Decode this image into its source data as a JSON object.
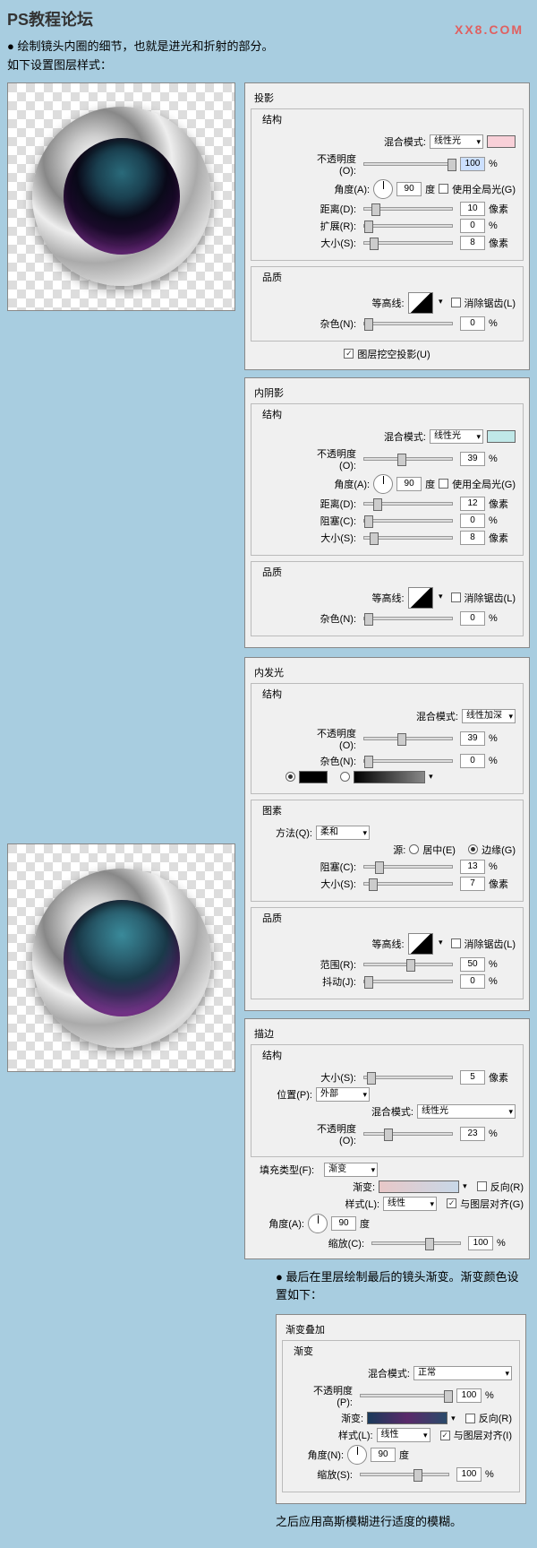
{
  "header": "PS教程论坛",
  "watermark": "XX8.COM",
  "intro1": "● 绘制镜头内圈的细节，也就是进光和折射的部分。",
  "intro2": "如下设置图层样式：",
  "p1": {
    "title": "投影",
    "group": "结构",
    "blend_lbl": "混合模式:",
    "blend": "线性光",
    "opac_lbl": "不透明度(O):",
    "opac": "100",
    "pct": "%",
    "angle_lbl": "角度(A):",
    "angle": "90",
    "deg": "度",
    "global_lbl": "使用全局光(G)",
    "dist_lbl": "距离(D):",
    "dist": "10",
    "px": "像素",
    "spread_lbl": "扩展(R):",
    "spread": "0",
    "size_lbl": "大小(S):",
    "size": "8",
    "quality": "品质",
    "contour_lbl": "等高线:",
    "aa_lbl": "消除锯齿(L)",
    "noise_lbl": "杂色(N):",
    "noise": "0",
    "knockout": "图层挖空投影(U)"
  },
  "p2": {
    "title": "内阴影",
    "group": "结构",
    "blend_lbl": "混合模式:",
    "blend": "线性光",
    "opac_lbl": "不透明度(O):",
    "opac": "39",
    "pct": "%",
    "angle_lbl": "角度(A):",
    "angle": "90",
    "deg": "度",
    "global_lbl": "使用全局光(G)",
    "dist_lbl": "距离(D):",
    "dist": "12",
    "px": "像素",
    "choke_lbl": "阻塞(C):",
    "choke": "0",
    "size_lbl": "大小(S):",
    "size": "8",
    "quality": "品质",
    "contour_lbl": "等高线:",
    "aa_lbl": "消除锯齿(L)",
    "noise_lbl": "杂色(N):",
    "noise": "0"
  },
  "p3": {
    "title": "内发光",
    "group": "结构",
    "blend_lbl": "混合模式:",
    "blend": "线性加深",
    "opac_lbl": "不透明度(O):",
    "opac": "39",
    "pct": "%",
    "noise_lbl": "杂色(N):",
    "noise": "0",
    "elements": "图素",
    "method_lbl": "方法(Q):",
    "method": "柔和",
    "source_lbl": "源:",
    "center": "居中(E)",
    "edge": "边缘(G)",
    "choke_lbl": "阻塞(C):",
    "choke": "13",
    "size_lbl": "大小(S):",
    "size": "7",
    "px": "像素",
    "quality": "品质",
    "contour_lbl": "等高线:",
    "aa_lbl": "消除锯齿(L)",
    "range_lbl": "范围(R):",
    "range": "50",
    "jitter_lbl": "抖动(J):",
    "jitter": "0"
  },
  "p4": {
    "title": "描边",
    "group": "结构",
    "size_lbl": "大小(S):",
    "size": "5",
    "px": "像素",
    "pos_lbl": "位置(P):",
    "pos": "外部",
    "blend_lbl": "混合模式:",
    "blend": "线性光",
    "opac_lbl": "不透明度(O):",
    "opac": "23",
    "pct": "%",
    "fill_lbl": "填充类型(F):",
    "fill": "渐变",
    "grad_lbl": "渐变:",
    "rev_lbl": "反向(R)",
    "style_lbl": "样式(L):",
    "style": "线性",
    "align_lbl": "与图层对齐(G)",
    "angle_lbl": "角度(A):",
    "angle": "90",
    "deg": "度",
    "scale_lbl": "缩放(C):",
    "scale": "100"
  },
  "outro1": "● 最后在里层绘制最后的镜头渐变。渐变颜色设置如下：",
  "p5": {
    "title": "渐变叠加",
    "group": "渐变",
    "blend_lbl": "混合模式:",
    "blend": "正常",
    "opac_lbl": "不透明度(P):",
    "opac": "100",
    "pct": "%",
    "grad_lbl": "渐变:",
    "rev_lbl": "反向(R)",
    "style_lbl": "样式(L):",
    "style": "线性",
    "align_lbl": "与图层对齐(I)",
    "angle_lbl": "角度(N):",
    "angle": "90",
    "deg": "度",
    "scale_lbl": "缩放(S):",
    "scale": "100"
  },
  "outro2": "之后应用高斯模糊进行适度的模糊。"
}
